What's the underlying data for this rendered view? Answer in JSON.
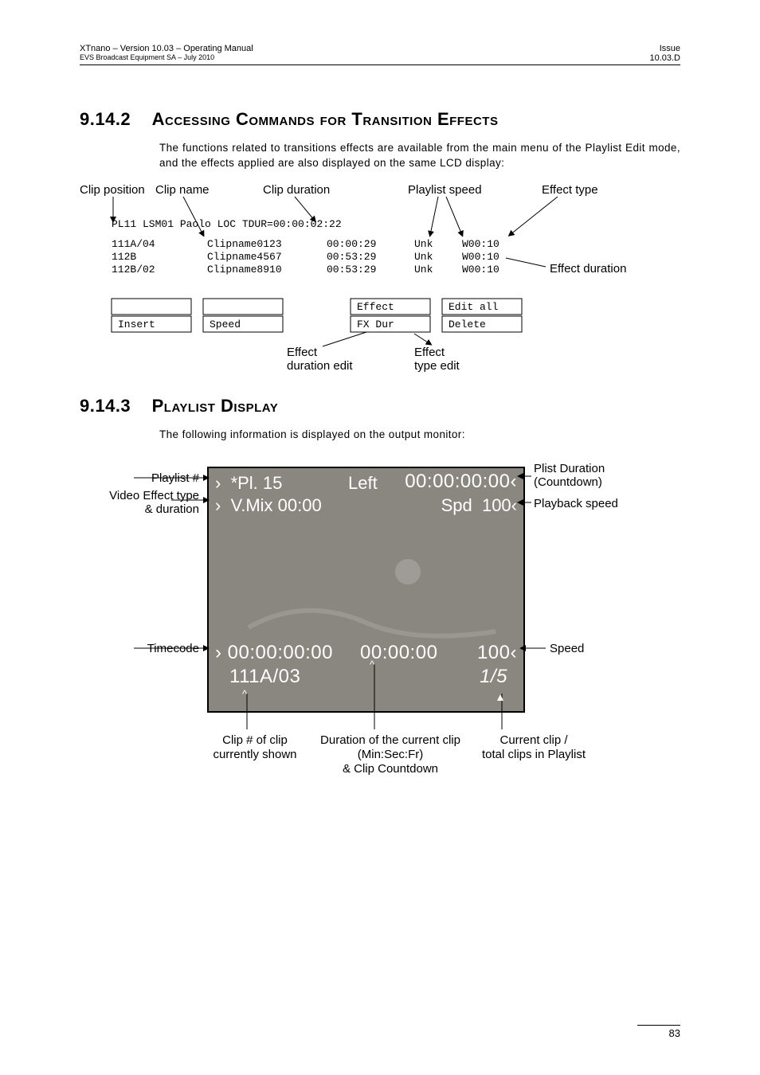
{
  "header": {
    "left_line1": "XTnano – Version 10.03 – Operating Manual",
    "left_line2": "EVS Broadcast Equipment SA – July 2010",
    "right_line1": "Issue",
    "right_line2": "10.03.D"
  },
  "section1": {
    "number": "9.14.2",
    "title": "Accessing Commands for Transition Effects",
    "text": "The functions related to transitions effects are available from the main menu of the Playlist Edit mode, and the effects applied are also displayed on the same LCD display:"
  },
  "fig1": {
    "top_labels": {
      "clip_position": "Clip position",
      "clip_name": "Clip name",
      "clip_duration": "Clip duration",
      "playlist_speed": "Playlist speed",
      "effect_type": "Effect type"
    },
    "lcd": {
      "title": "PL11 LSM01 Paolo     LOC TDUR=00:00:02:22",
      "rows": [
        {
          "id": "111A/04",
          "name": "Clipname0123",
          "dur": "00:00:29",
          "spd": "Unk",
          "eff": "W00:10"
        },
        {
          "id": "112B",
          "name": "Clipname4567",
          "dur": "00:53:29",
          "spd": "Unk",
          "eff": "W00:10"
        },
        {
          "id": "112B/02",
          "name": "Clipname8910",
          "dur": "00:53:29",
          "spd": "Unk",
          "eff": "W00:10"
        }
      ],
      "buttons": {
        "c1_top": "",
        "c1_bot": "Insert",
        "c2_top": "",
        "c2_bot": "Speed",
        "c3_top": "Effect",
        "c3_bot": "FX Dur",
        "c4_top": "Edit all",
        "c4_bot": "Delete"
      }
    },
    "right_label": "Effect duration",
    "bottom_labels": {
      "eff_dur_edit_l1": "Effect",
      "eff_dur_edit_l2": "duration edit",
      "eff_type_edit_l1": "Effect",
      "eff_type_edit_l2": "type edit"
    }
  },
  "section2": {
    "number": "9.14.3",
    "title": "Playlist Display",
    "text": "The following information is displayed on the output monitor:"
  },
  "fig2": {
    "left_labels": {
      "playlist_num": "Playlist #",
      "video_eff_l1": "Video Effect type",
      "video_eff_l2": "& duration",
      "timecode": "Timecode"
    },
    "right_labels": {
      "plist_dur_l1": "Plist Duration",
      "plist_dur_l2": "(Countdown)",
      "playback_speed": "Playback speed",
      "speed": "Speed"
    },
    "monitor": {
      "pl_label": "*Pl.  15",
      "left_label": "Left",
      "left_time": "00:00:00:00",
      "vmix": "V.Mix  00:00",
      "spd_label": "Spd",
      "spd_val": "100",
      "tc": "00:00:00:00",
      "clip_dur": "00:00:00",
      "clip_spd": "100",
      "clip_id": "111A/03",
      "clip_count": "1/5"
    },
    "bottom_labels": {
      "clip_shown_l1": "Clip # of clip",
      "clip_shown_l2": "currently shown",
      "dur_l1": "Duration of the current clip",
      "dur_l2": "(Min:Sec:Fr)",
      "dur_l3": "& Clip Countdown",
      "cur_l1": "Current clip /",
      "cur_l2": "total clips in Playlist"
    }
  },
  "page_number": "83"
}
